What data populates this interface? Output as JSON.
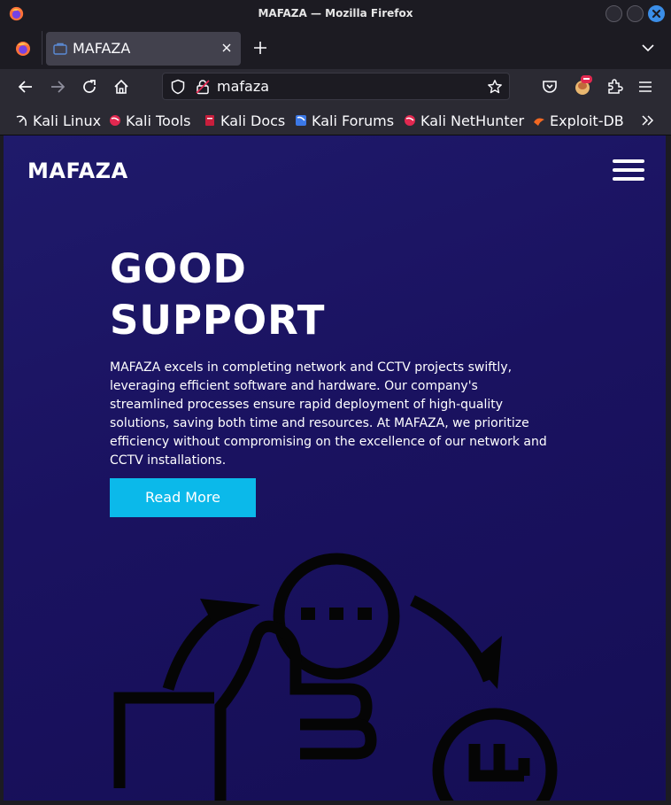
{
  "window": {
    "title": "MAFAZA — Mozilla Firefox"
  },
  "tabs": [
    {
      "label": "MAFAZA"
    }
  ],
  "urlbar": {
    "value": "mafaza"
  },
  "bookmarks": [
    {
      "label": "Kali Linux",
      "icon": "kali-dragon-icon"
    },
    {
      "label": "Kali Tools",
      "icon": "kali-tools-icon"
    },
    {
      "label": "Kali Docs",
      "icon": "kali-docs-icon"
    },
    {
      "label": "Kali Forums",
      "icon": "kali-forums-icon"
    },
    {
      "label": "Kali NetHunter",
      "icon": "kali-nethunter-icon"
    },
    {
      "label": "Exploit-DB",
      "icon": "exploit-db-icon"
    }
  ],
  "site": {
    "brand": "MAFAZA",
    "headline_line1": "GOOD",
    "headline_line2": "SUPPORT",
    "paragraph": "MAFAZA excels in completing network and CCTV projects swiftly, leveraging efficient software and hardware. Our company's streamlined processes ensure rapid deployment of high-quality solutions, saving both time and resources. At MAFAZA, we prioritize efficiency without compromising on the excellence of our network and CCTV installations.",
    "cta_label": "Read More"
  },
  "colors": {
    "page_background": "#1a1260",
    "cta_background": "#0bb9ea",
    "illustration_stroke": "#050505",
    "browser_chrome": "#2b2a33"
  }
}
